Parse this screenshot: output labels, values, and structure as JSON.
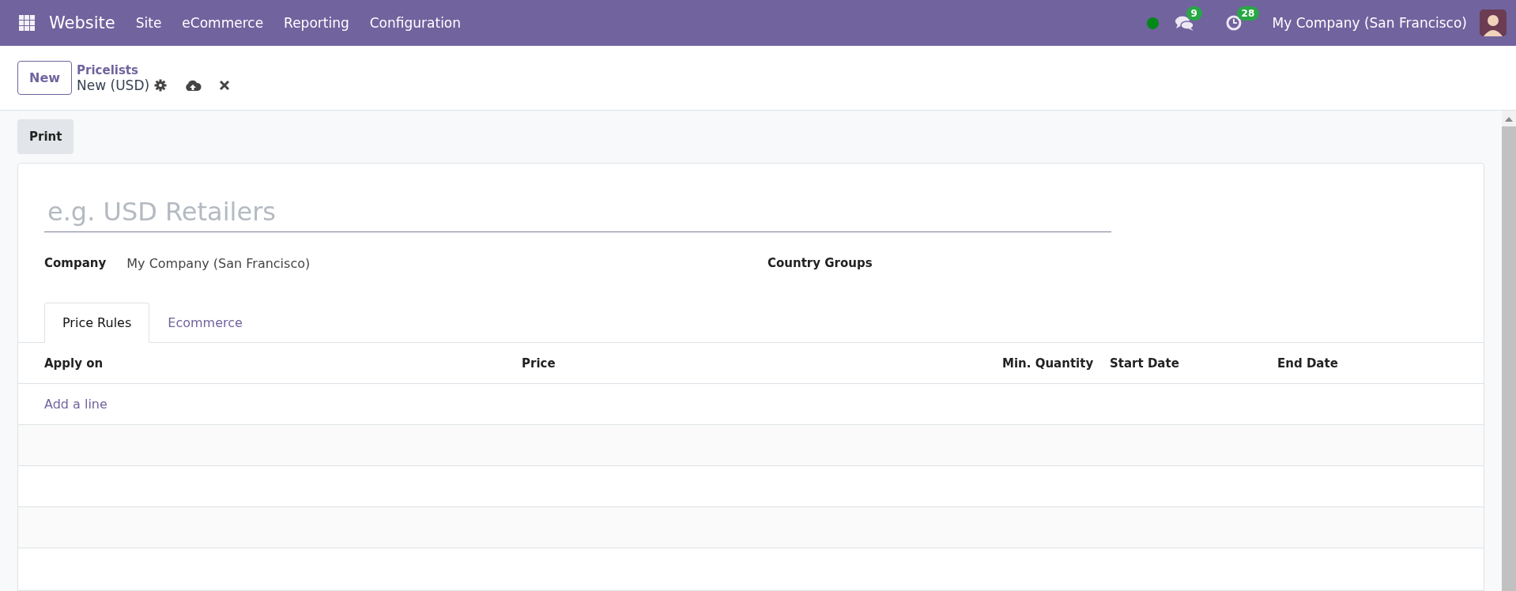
{
  "navbar": {
    "app_name": "Website",
    "menus": [
      "Site",
      "eCommerce",
      "Reporting",
      "Configuration"
    ],
    "messages_count": "9",
    "activities_count": "28",
    "company": "My Company (San Francisco)"
  },
  "control_panel": {
    "new_button": "New",
    "breadcrumb": "Pricelists",
    "record": "New (USD)"
  },
  "actions": {
    "print_button": "Print"
  },
  "form": {
    "name_placeholder": "e.g. USD Retailers",
    "fields": [
      {
        "label": "Company",
        "value": "My Company (San Francisco)"
      },
      {
        "label": "Country Groups"
      }
    ],
    "tabs": [
      {
        "label": "Price Rules",
        "selected": true
      },
      {
        "label": "Ecommerce",
        "selected": false
      }
    ],
    "table": {
      "columns": [
        "Apply on",
        "Price",
        "Min. Quantity",
        "Start Date",
        "End Date"
      ],
      "add_line": "Add a line"
    }
  }
}
